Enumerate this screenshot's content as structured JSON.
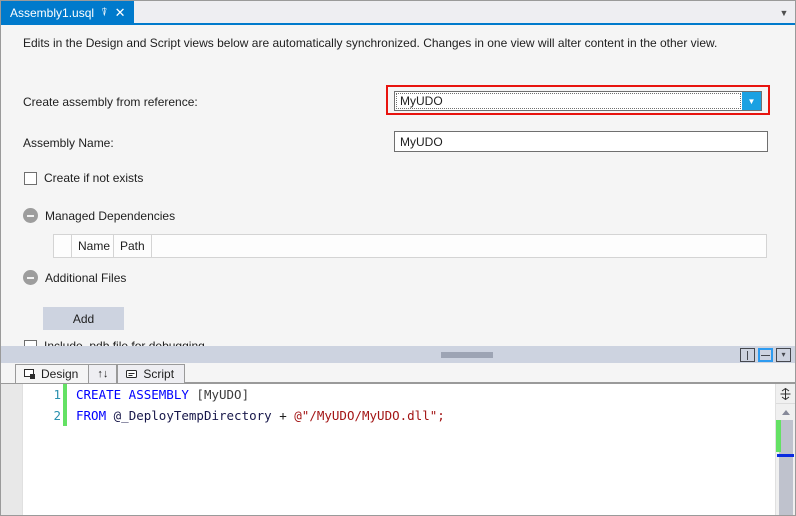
{
  "window": {
    "tab": {
      "title": "Assembly1.usql",
      "pin_icon": "pin-icon",
      "close_icon": "close-icon",
      "overflow_icon": "chevron-down-icon"
    }
  },
  "designer": {
    "info_text": "Edits in the Design and Script views below are automatically synchronized. Changes in one view will alter content in the other view.",
    "reference_row": {
      "label": "Create assembly from reference:",
      "value": "MyUDO",
      "dropdown_icon": "chevron-down-icon",
      "highlight_color": "#e8130e"
    },
    "assembly_name_row": {
      "label": "Assembly Name:",
      "value": "MyUDO"
    },
    "create_if_not_exists": {
      "label": "Create if not exists",
      "checked": false
    },
    "managed_dependencies": {
      "label": "Managed Dependencies",
      "expanded": true,
      "columns": [
        "Name",
        "Path"
      ],
      "rows": []
    },
    "additional_files": {
      "label": "Additional Files",
      "expanded": true,
      "add_label": "Add"
    },
    "include_pdb": {
      "label": "Include .pdb file for debugging",
      "checked": false
    },
    "view_buttons": {
      "vertical_split": "split-vertical-icon",
      "horizontal_split": "split-horizontal-icon",
      "collapse": "double-chevron-down-icon"
    }
  },
  "view_tabs": {
    "design": "Design",
    "swap": "↑↓",
    "script": "Script"
  },
  "editor": {
    "lines": [
      {
        "number": "1",
        "tokens": [
          {
            "text": "CREATE ASSEMBLY ",
            "cls": "tok-kw"
          },
          {
            "text": "[MyUDO]",
            "cls": "tok-name"
          }
        ]
      },
      {
        "number": "2",
        "tokens": [
          {
            "text": "FROM ",
            "cls": "tok-kw"
          },
          {
            "text": "@_DeployTempDirectory",
            "cls": "tok-ident"
          },
          {
            "text": " + ",
            "cls": "tok-op"
          },
          {
            "text": "@\"/MyUDO/MyUDO.dll\";",
            "cls": "tok-str"
          }
        ]
      }
    ],
    "split_button_icon": "split-editor-icon",
    "scroll_up_icon": "arrow-up-icon",
    "change_bar_color": "#64e164"
  }
}
